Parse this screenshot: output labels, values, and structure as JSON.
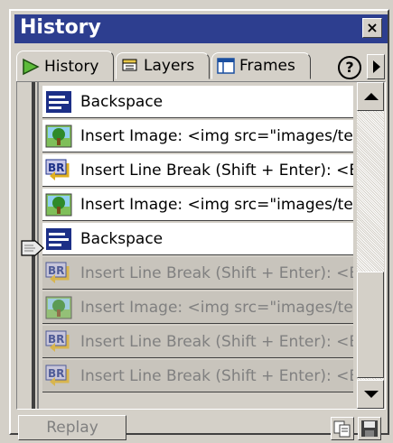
{
  "panel": {
    "title": "History",
    "close_label": "×"
  },
  "tabs": [
    {
      "label": "History",
      "icon": "play-icon",
      "active": true
    },
    {
      "label": "Layers",
      "icon": "layers-icon",
      "active": false
    },
    {
      "label": "Frames",
      "icon": "frames-icon",
      "active": false
    }
  ],
  "help_label": "?",
  "history_items": [
    {
      "label": "Backspace",
      "icon": "backspace-icon",
      "state": "done"
    },
    {
      "label": "Insert Image: <img src=\"images/temp",
      "icon": "image-icon",
      "state": "done"
    },
    {
      "label": "Insert Line Break (Shift + Enter): <BR",
      "icon": "line-break-icon",
      "state": "done"
    },
    {
      "label": "Insert Image: <img src=\"images/temp",
      "icon": "image-icon",
      "state": "done"
    },
    {
      "label": "Backspace",
      "icon": "backspace-icon",
      "state": "done"
    },
    {
      "label": "Insert Line Break (Shift + Enter): <BR",
      "icon": "line-break-icon",
      "state": "undone"
    },
    {
      "label": "Insert Image: <img src=\"images/temp",
      "icon": "image-icon",
      "state": "undone"
    },
    {
      "label": "Insert Line Break (Shift + Enter): <BR",
      "icon": "line-break-icon",
      "state": "undone"
    },
    {
      "label": "Insert Line Break (Shift + Enter): <BR",
      "icon": "line-break-icon",
      "state": "undone"
    }
  ],
  "footer": {
    "replay_label": "Replay"
  },
  "colors": {
    "titlebar": "#2d3e8f",
    "panel": "#d4d0c8",
    "done_row": "#ffffff",
    "undone_row": "#c8c4bc"
  }
}
